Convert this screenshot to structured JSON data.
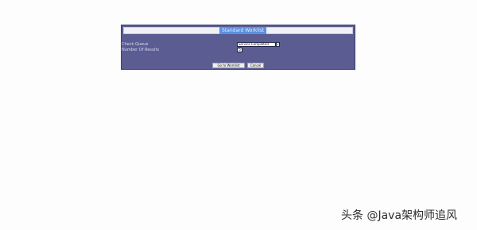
{
  "form": {
    "title": "Standard Worklist",
    "fields": [
      {
        "label": "Check Queue",
        "value": "Service Completed",
        "arrow": "v"
      },
      {
        "label": "Number Of Results",
        "value": "5"
      }
    ],
    "buttons": {
      "submit": "Go to Worklist",
      "cancel": "Cancel"
    },
    "colors": {
      "panel": "#5a5c92",
      "title_highlight": "#5b8fe0",
      "page_background": "#fdfdfe"
    }
  },
  "watermark": {
    "text": "头条 @Java架构师追风"
  }
}
